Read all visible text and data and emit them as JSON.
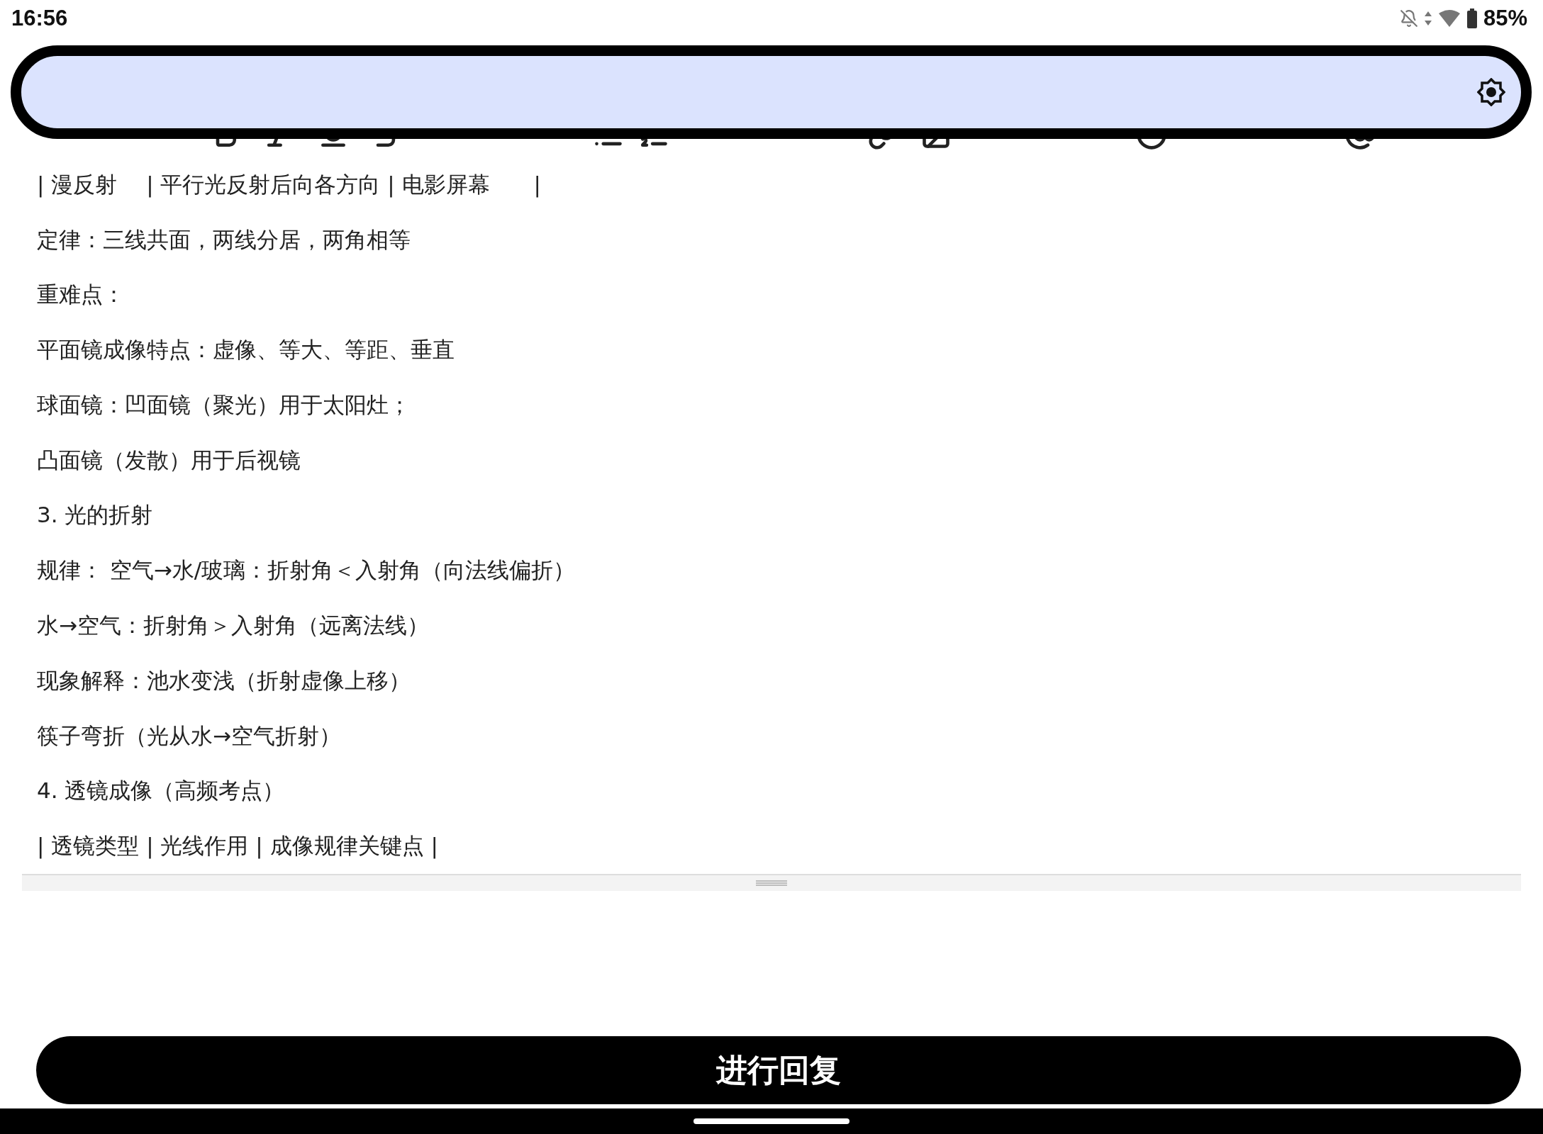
{
  "status_bar": {
    "time": "16:56",
    "battery": "85%"
  },
  "editor": {
    "lines": [
      "| 漫反射　 | 平行光反射后向各方向 | 电影屏幕　　|",
      "定律：三线共面，两线分居，两角相等",
      "重难点：",
      "平面镜成像特点：虚像、等大、等距、垂直",
      "球面镜：凹面镜（聚光）用于太阳灶；",
      "凸面镜（发散）用于后视镜",
      "3. 光的折射",
      "规律： 空气→水/玻璃：折射角＜入射角（向法线偏折）",
      "水→空气：折射角＞入射角（远离法线）",
      "现象解释：池水变浅（折射虚像上移）",
      "筷子弯折（光从水→空气折射）",
      "4. 透镜成像（高频考点）",
      "| 透镜类型 | 光线作用 | 成像规律关键点 |"
    ]
  },
  "reply_button": {
    "label": "进行回复"
  }
}
